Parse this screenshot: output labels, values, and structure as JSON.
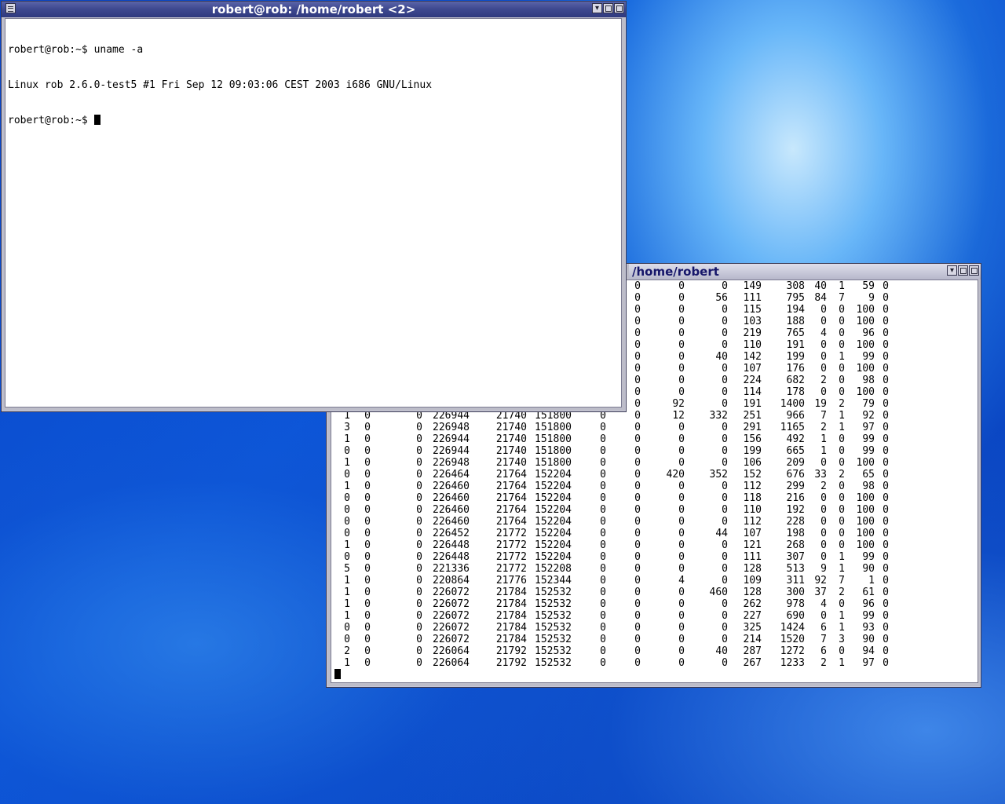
{
  "windows": {
    "back": {
      "title": "/home/robert",
      "vmstat_rows": [
        [
          "0",
          "0",
          "0",
          "149",
          "308",
          "40",
          "1",
          "59",
          "0"
        ],
        [
          "0",
          "0",
          "56",
          "111",
          "795",
          "84",
          "7",
          "9",
          "0"
        ],
        [
          "0",
          "0",
          "0",
          "115",
          "194",
          "0",
          "0",
          "100",
          "0"
        ],
        [
          "0",
          "0",
          "0",
          "103",
          "188",
          "0",
          "0",
          "100",
          "0"
        ],
        [
          "0",
          "0",
          "0",
          "219",
          "765",
          "4",
          "0",
          "96",
          "0"
        ],
        [
          "0",
          "0",
          "0",
          "110",
          "191",
          "0",
          "0",
          "100",
          "0"
        ],
        [
          "0",
          "0",
          "40",
          "142",
          "199",
          "0",
          "1",
          "99",
          "0"
        ],
        [
          "0",
          "0",
          "0",
          "107",
          "176",
          "0",
          "0",
          "100",
          "0"
        ],
        [
          "0",
          "0",
          "0",
          "224",
          "682",
          "2",
          "0",
          "98",
          "0"
        ],
        [
          "0",
          "0",
          "0",
          "114",
          "178",
          "0",
          "0",
          "100",
          "0"
        ],
        [
          "0",
          "92",
          "0",
          "191",
          "1400",
          "19",
          "2",
          "79",
          "0"
        ],
        [
          "1",
          "0",
          "0",
          "226944",
          "21740",
          "151800",
          "0",
          "0",
          "12",
          "332",
          "251",
          "966",
          "7",
          "1",
          "92",
          "0"
        ],
        [
          "3",
          "0",
          "0",
          "226948",
          "21740",
          "151800",
          "0",
          "0",
          "0",
          "0",
          "291",
          "1165",
          "2",
          "1",
          "97",
          "0"
        ],
        [
          "1",
          "0",
          "0",
          "226944",
          "21740",
          "151800",
          "0",
          "0",
          "0",
          "0",
          "156",
          "492",
          "1",
          "0",
          "99",
          "0"
        ],
        [
          "0",
          "0",
          "0",
          "226944",
          "21740",
          "151800",
          "0",
          "0",
          "0",
          "0",
          "199",
          "665",
          "1",
          "0",
          "99",
          "0"
        ],
        [
          "1",
          "0",
          "0",
          "226948",
          "21740",
          "151800",
          "0",
          "0",
          "0",
          "0",
          "106",
          "209",
          "0",
          "0",
          "100",
          "0"
        ],
        [
          "0",
          "0",
          "0",
          "226464",
          "21764",
          "152204",
          "0",
          "0",
          "420",
          "352",
          "152",
          "676",
          "33",
          "2",
          "65",
          "0"
        ],
        [
          "1",
          "0",
          "0",
          "226460",
          "21764",
          "152204",
          "0",
          "0",
          "0",
          "0",
          "112",
          "299",
          "2",
          "0",
          "98",
          "0"
        ],
        [
          "0",
          "0",
          "0",
          "226460",
          "21764",
          "152204",
          "0",
          "0",
          "0",
          "0",
          "118",
          "216",
          "0",
          "0",
          "100",
          "0"
        ],
        [
          "0",
          "0",
          "0",
          "226460",
          "21764",
          "152204",
          "0",
          "0",
          "0",
          "0",
          "110",
          "192",
          "0",
          "0",
          "100",
          "0"
        ],
        [
          "0",
          "0",
          "0",
          "226460",
          "21764",
          "152204",
          "0",
          "0",
          "0",
          "0",
          "112",
          "228",
          "0",
          "0",
          "100",
          "0"
        ],
        [
          "0",
          "0",
          "0",
          "226452",
          "21772",
          "152204",
          "0",
          "0",
          "0",
          "44",
          "107",
          "198",
          "0",
          "0",
          "100",
          "0"
        ],
        [
          "1",
          "0",
          "0",
          "226448",
          "21772",
          "152204",
          "0",
          "0",
          "0",
          "0",
          "121",
          "268",
          "0",
          "0",
          "100",
          "0"
        ],
        [
          "0",
          "0",
          "0",
          "226448",
          "21772",
          "152204",
          "0",
          "0",
          "0",
          "0",
          "111",
          "307",
          "0",
          "1",
          "99",
          "0"
        ],
        [
          "5",
          "0",
          "0",
          "221336",
          "21772",
          "152208",
          "0",
          "0",
          "0",
          "0",
          "128",
          "513",
          "9",
          "1",
          "90",
          "0"
        ],
        [
          "1",
          "0",
          "0",
          "220864",
          "21776",
          "152344",
          "0",
          "0",
          "4",
          "0",
          "109",
          "311",
          "92",
          "7",
          "1",
          "0"
        ],
        [
          "1",
          "0",
          "0",
          "226072",
          "21784",
          "152532",
          "0",
          "0",
          "0",
          "460",
          "128",
          "300",
          "37",
          "2",
          "61",
          "0"
        ],
        [
          "1",
          "0",
          "0",
          "226072",
          "21784",
          "152532",
          "0",
          "0",
          "0",
          "0",
          "262",
          "978",
          "4",
          "0",
          "96",
          "0"
        ],
        [
          "1",
          "0",
          "0",
          "226072",
          "21784",
          "152532",
          "0",
          "0",
          "0",
          "0",
          "227",
          "690",
          "0",
          "1",
          "99",
          "0"
        ],
        [
          "0",
          "0",
          "0",
          "226072",
          "21784",
          "152532",
          "0",
          "0",
          "0",
          "0",
          "325",
          "1424",
          "6",
          "1",
          "93",
          "0"
        ],
        [
          "0",
          "0",
          "0",
          "226072",
          "21784",
          "152532",
          "0",
          "0",
          "0",
          "0",
          "214",
          "1520",
          "7",
          "3",
          "90",
          "0"
        ],
        [
          "2",
          "0",
          "0",
          "226064",
          "21792",
          "152532",
          "0",
          "0",
          "0",
          "40",
          "287",
          "1272",
          "6",
          "0",
          "94",
          "0"
        ],
        [
          "1",
          "0",
          "0",
          "226064",
          "21792",
          "152532",
          "0",
          "0",
          "0",
          "0",
          "267",
          "1233",
          "2",
          "1",
          "97",
          "0"
        ]
      ]
    },
    "front": {
      "title": "robert@rob: /home/robert <2>",
      "lines": [
        "robert@rob:~$ uname -a",
        "Linux rob 2.6.0-test5 #1 Fri Sep 12 09:03:06 CEST 2003 i686 GNU/Linux",
        "robert@rob:~$ "
      ]
    }
  },
  "buttons": {
    "minimize_glyph": "▾"
  },
  "colors": {
    "active_title": "#3f4a91",
    "inactive_title": "#c6c7d8",
    "inactive_title_text": "#16166a",
    "desktop": "#0a46c8"
  }
}
